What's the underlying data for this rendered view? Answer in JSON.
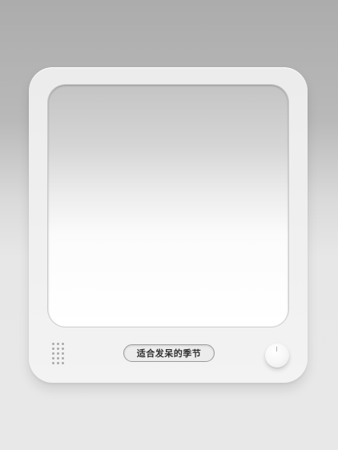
{
  "tv": {
    "title": "适合发呆的季节"
  },
  "speaker": {
    "icon": "speaker-grille-icon"
  },
  "knob": {
    "icon": "dial-knob-icon"
  }
}
